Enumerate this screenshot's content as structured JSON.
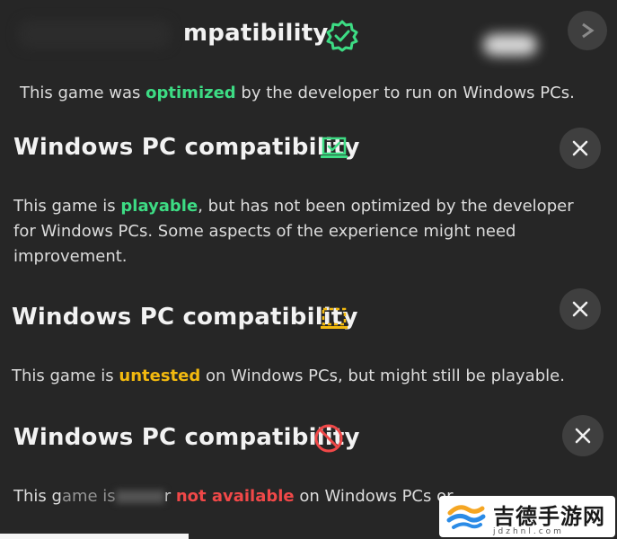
{
  "sections": [
    {
      "title": "mpatibility",
      "status": "optimized",
      "icon": "verified-badge-icon",
      "color": "#3ddc84",
      "desc_before": "This game was ",
      "desc_highlight": "optimized",
      "desc_after": " by the developer to run on Windows PCs."
    },
    {
      "title": "Windows PC compatibility",
      "status": "playable",
      "icon": "laptop-check-icon",
      "color": "#3ddc84",
      "desc_before": "This game is ",
      "desc_highlight": "playable",
      "desc_after": ", but has not been optimized by the developer for Windows PCs. Some aspects of the experience might need improvement."
    },
    {
      "title": "Windows PC compatibility",
      "status": "untested",
      "icon": "dashed-screen-icon",
      "color": "#f2b90f",
      "desc_before": "This game is ",
      "desc_highlight": "untested",
      "desc_after": " on Windows PCs, but might still be playable."
    },
    {
      "title": "Windows PC compatibility",
      "status": "not available",
      "icon": "prohibited-icon",
      "color": "#f04848",
      "desc_before": "This g",
      "desc_mid": "ame is",
      "desc_mid2": "r ",
      "desc_highlight": "not available",
      "desc_after": " on Windows PCs or "
    }
  ],
  "watermark": {
    "text": "吉德手游网",
    "sub": "jdzhnl.com"
  }
}
